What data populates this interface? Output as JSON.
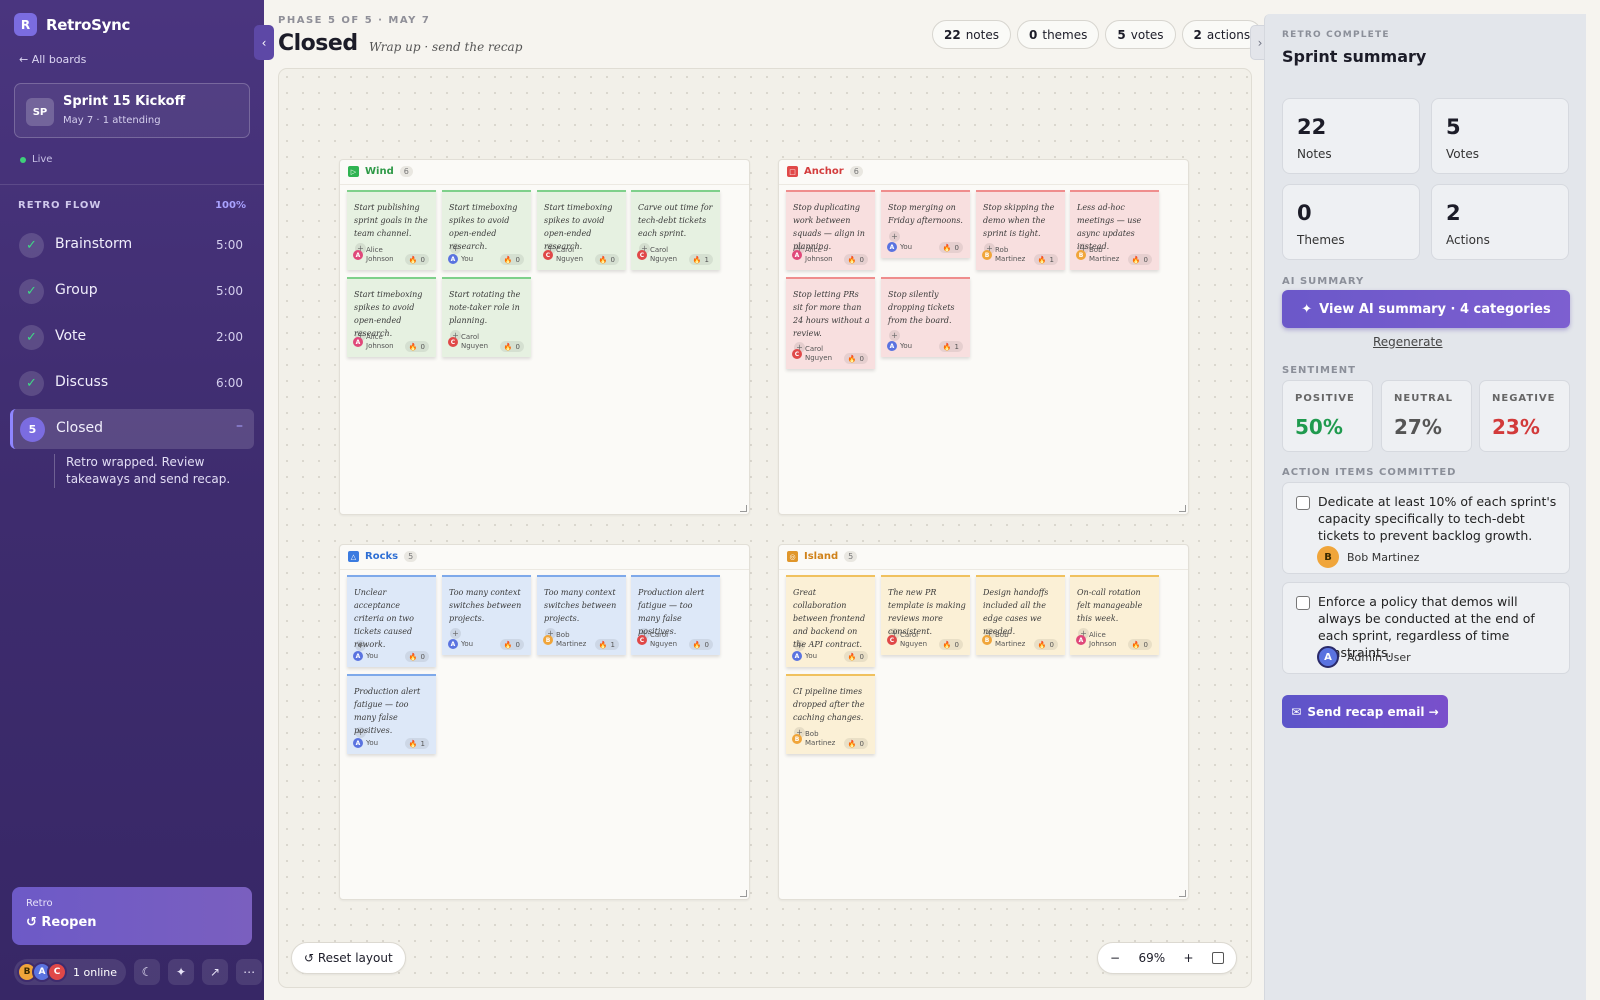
{
  "app": {
    "logo_letter": "R",
    "name": "RetroSync",
    "back_link": "← All boards"
  },
  "board": {
    "initials": "SP",
    "title": "Sprint 15 Kickoff",
    "subtitle": "May 7 · 1 attending",
    "status": "Live"
  },
  "flow": {
    "title": "RETRO FLOW",
    "progress_label": "100%",
    "steps": [
      {
        "label": "Brainstorm",
        "time": "5:00"
      },
      {
        "label": "Group",
        "time": "5:00"
      },
      {
        "label": "Vote",
        "time": "2:00"
      },
      {
        "label": "Discuss",
        "time": "6:00"
      }
    ],
    "active": {
      "number": "5",
      "label": "Closed",
      "collapse": "–",
      "description": "Retro wrapped. Review takeaways and send recap."
    }
  },
  "reopen": {
    "kicker": "Retro",
    "label": "↺ Reopen"
  },
  "presence": {
    "avatars": [
      "B",
      "A",
      "C"
    ],
    "online": "1 online"
  },
  "header": {
    "phase": "PHASE 5 OF 5 · MAY 7",
    "title": "Closed",
    "subtitle": "Wrap up · send the recap",
    "stats": [
      {
        "value": "22",
        "label": "notes"
      },
      {
        "value": "0",
        "label": "themes"
      },
      {
        "value": "5",
        "label": "votes"
      },
      {
        "value": "2",
        "label": "actions"
      }
    ]
  },
  "zones": {
    "wind": {
      "title": "Wind",
      "count": "6",
      "color": "#2fb351",
      "icon": "wind-icon"
    },
    "anchor": {
      "title": "Anchor",
      "count": "6",
      "color": "#e04848",
      "icon": "anchor-icon"
    },
    "rocks": {
      "title": "Rocks",
      "count": "5",
      "color": "#3b7be0",
      "icon": "rocks-icon"
    },
    "island": {
      "title": "Island",
      "count": "5",
      "color": "#e0962a",
      "icon": "island-icon"
    }
  },
  "notes": {
    "wind": [
      {
        "text": "Start publishing sprint goals in the team channel.",
        "author": "Alice Johnson",
        "initial": "A",
        "votes": "0"
      },
      {
        "text": "Start timeboxing spikes to avoid open-ended research.",
        "author": "You",
        "initial": "A",
        "votes": "0"
      },
      {
        "text": "Start timeboxing spikes to avoid open-ended research.",
        "author": "Carol Nguyen",
        "initial": "C",
        "votes": "0"
      },
      {
        "text": "Carve out time for tech-debt tickets each sprint.",
        "author": "Carol Nguyen",
        "initial": "C",
        "votes": "1"
      },
      {
        "text": "Start timeboxing spikes to avoid open-ended research.",
        "author": "Alice Johnson",
        "initial": "A",
        "votes": "0"
      },
      {
        "text": "Start rotating the note-taker role in planning.",
        "author": "Carol Nguyen",
        "initial": "C",
        "votes": "0"
      }
    ],
    "anchor": [
      {
        "text": "Stop duplicating work between squads — align in planning.",
        "author": "Alice Johnson",
        "initial": "A",
        "votes": "0"
      },
      {
        "text": "Stop merging on Friday afternoons.",
        "author": "You",
        "initial": "A",
        "votes": "0"
      },
      {
        "text": "Stop skipping the demo when the sprint is tight.",
        "author": "Rob Martinez",
        "initial": "B",
        "votes": "1"
      },
      {
        "text": "Less ad-hoc meetings — use async updates instead.",
        "author": "Bob Martinez",
        "initial": "B",
        "votes": "0"
      },
      {
        "text": "Stop letting PRs sit for more than 24 hours without a review.",
        "author": "Carol Nguyen",
        "initial": "C",
        "votes": "0"
      },
      {
        "text": "Stop silently dropping tickets from the board.",
        "author": "You",
        "initial": "A",
        "votes": "1"
      }
    ],
    "rocks": [
      {
        "text": "Unclear acceptance criteria on two tickets caused rework.",
        "author": "You",
        "initial": "A",
        "votes": "0"
      },
      {
        "text": "Too many context switches between projects.",
        "author": "You",
        "initial": "A",
        "votes": "0"
      },
      {
        "text": "Too many context switches between projects.",
        "author": "Bob Martinez",
        "initial": "B",
        "votes": "1"
      },
      {
        "text": "Production alert fatigue — too many false positives.",
        "author": "Carol Nguyen",
        "initial": "C",
        "votes": "0"
      },
      {
        "text": "Production alert fatigue — too many false positives.",
        "author": "You",
        "initial": "A",
        "votes": "1"
      }
    ],
    "island": [
      {
        "text": "Great collaboration between frontend and backend on the API contract.",
        "author": "You",
        "initial": "A",
        "votes": "0"
      },
      {
        "text": "The new PR template is making reviews more consistent.",
        "author": "Carol Nguyen",
        "initial": "C",
        "votes": "0"
      },
      {
        "text": "Design handoffs included all the edge cases we needed.",
        "author": "Bob Martinez",
        "initial": "B",
        "votes": "0"
      },
      {
        "text": "On-call rotation felt manageable this week.",
        "author": "Alice Johnson",
        "initial": "A",
        "votes": "0"
      },
      {
        "text": "CI pipeline times dropped after the caching changes.",
        "author": "Bob Martinez",
        "initial": "B",
        "votes": "0"
      }
    ]
  },
  "canvas": {
    "reset_label": "↺ Reset layout",
    "zoom": "69%",
    "zoom_out": "−",
    "zoom_in": "+",
    "fit_icon": "fit-screen-icon"
  },
  "summary": {
    "kicker": "RETRO COMPLETE",
    "title": "Sprint summary",
    "tiles": [
      {
        "value": "22",
        "label": "Notes"
      },
      {
        "value": "5",
        "label": "Votes"
      },
      {
        "value": "0",
        "label": "Themes"
      },
      {
        "value": "2",
        "label": "Actions"
      }
    ],
    "ai_label": "AI SUMMARY",
    "ai_button": "View AI summary · 4 categories",
    "regenerate": "Regenerate",
    "sentiment_label": "SENTIMENT",
    "sentiment": [
      {
        "label": "POSITIVE",
        "value": "50%",
        "color": "#1f9a4e"
      },
      {
        "label": "NEUTRAL",
        "value": "27%",
        "color": "#555555"
      },
      {
        "label": "NEGATIVE",
        "value": "23%",
        "color": "#d23a3a"
      }
    ],
    "actions_label": "ACTION ITEMS COMMITTED",
    "actions": [
      {
        "text": "Dedicate at least 10% of each sprint's capacity specifically to tech-debt tickets to prevent backlog growth.",
        "owner": "Bob Martinez",
        "initial": "B"
      },
      {
        "text": "Enforce a policy that demos will always be conducted at the end of each sprint, regardless of time constraints.",
        "owner": "Admin User",
        "initial": "A"
      }
    ],
    "send_button": "Send recap email →"
  },
  "colors": {
    "accent": "#6b58c9",
    "sidebar": "#3e2c6e"
  }
}
